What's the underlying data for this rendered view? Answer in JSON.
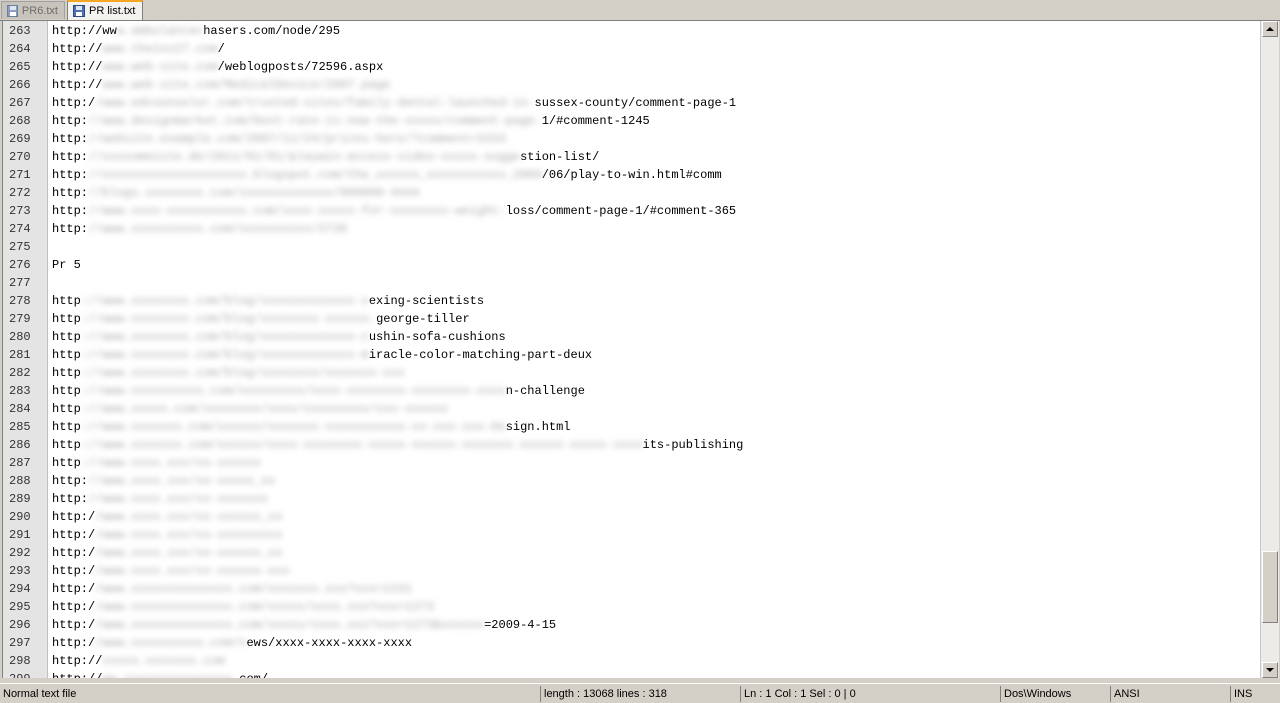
{
  "tabs": [
    {
      "label": "PR6.txt",
      "active": false
    },
    {
      "label": "PR list.txt",
      "active": true
    }
  ],
  "editor": {
    "lines": [
      {
        "n": "263",
        "pre": "http://ww",
        "blur": "w.ambulancec",
        "post": "hasers.com/node/295"
      },
      {
        "n": "264",
        "pre": "http://",
        "blur": "www.the1xx27.com",
        "post": "/"
      },
      {
        "n": "265",
        "pre": "http://",
        "blur": "www.web-site.com",
        "post": "/weblogposts/72596.aspx"
      },
      {
        "n": "266",
        "pre": "http://",
        "blur": "www.web-site.com/MedicalDevice/2007.page",
        "post": ""
      },
      {
        "n": "267",
        "pre": "http:/",
        "blur": "/www.edcounselor.com/trusted-sites/family-dental-launched-in-",
        "post": "sussex-county/comment-page-1"
      },
      {
        "n": "268",
        "pre": "http:",
        "blur": "//www.designmarket.com/best-rate-is-now-the-xxxxx/comment-page-",
        "post": "1/#comment-1245"
      },
      {
        "n": "269",
        "pre": "http:",
        "blur": "//website.example.com/2007/11/24/prices-here/?comment=3333",
        "post": ""
      },
      {
        "n": "270",
        "pre": "http:",
        "blur": "//xxxsomesite.de/2011/01/01/playwin-access-video-xxxxx-sugge",
        "post": "stion-list/"
      },
      {
        "n": "271",
        "pre": "http:",
        "blur": "//xxxxxxxxxxxxxxxxxxxx.blogspot.com/the_xxxxxx_xxxxxxxxxxx_2009",
        "post": "/06/play-to-win.html#comm"
      },
      {
        "n": "272",
        "pre": "http:",
        "blur": "//blogs.xxxxxxxx.com/xxxxxxxxxxxxx/000000-4444",
        "post": ""
      },
      {
        "n": "273",
        "pre": "http:",
        "blur": "//www.xxxx-xxxxxxxxxxx.com/xxxx-xxxxx-for-xxxxxxxx-weight-",
        "post": "loss/comment-page-1/#comment-365"
      },
      {
        "n": "274",
        "pre": "http:",
        "blur": "//www.xxxxxxxxxx.com/xxxxxxxxxx/2720",
        "post": ""
      },
      {
        "n": "275",
        "pre": "",
        "blur": "",
        "post": ""
      },
      {
        "n": "276",
        "pre": "Pr 5",
        "blur": "",
        "post": ""
      },
      {
        "n": "277",
        "pre": "",
        "blur": "",
        "post": ""
      },
      {
        "n": "278",
        "pre": "http",
        "blur": "://www.xxxxxxxx.com/blog/xxxxxxxxxxxxx-v",
        "post": "exing-scientists"
      },
      {
        "n": "279",
        "pre": "http",
        "blur": "://www.xxxxxxxx.com/blog/xxxxxxxx-xxxxxx-",
        "post": "george-tiller"
      },
      {
        "n": "280",
        "pre": "http",
        "blur": "://www.xxxxxxxx.com/blog/xxxxxxxxxxxxx-c",
        "post": "ushin-sofa-cushions"
      },
      {
        "n": "281",
        "pre": "http",
        "blur": "://www.xxxxxxxx.com/blog/xxxxxxxxxxxxx-m",
        "post": "iracle-color-matching-part-deux"
      },
      {
        "n": "282",
        "pre": "http",
        "blur": "://www.xxxxxxxx.com/blog/xxxxxxxx/xxxxxxx-xxx",
        "post": ""
      },
      {
        "n": "283",
        "pre": "http",
        "blur": "://www.xxxxxxxxxx.com/xxxxxxxxx/xxxx-xxxxxxxx-xxxxxxxx-xxxx",
        "post": "n-challenge"
      },
      {
        "n": "284",
        "pre": "http",
        "blur": "://www.xxxxx.com/xxxxxxxx/xxxx/xxxxxxxxx/xxx-xxxxxx",
        "post": ""
      },
      {
        "n": "285",
        "pre": "http",
        "blur": "://www.xxxxxxx.com/xxxxxx/xxxxxxx-xxxxxxxxxxx-xx-xxx-xxx-De",
        "post": "sign.html"
      },
      {
        "n": "286",
        "pre": "http",
        "blur": "://www.xxxxxxx.com/xxxxxx/xxxx-xxxxxxxx-xxxxx-xxxxxx-xxxxxxx-xxxxxx-xxxxx-xxxx",
        "post": "its-publishing"
      },
      {
        "n": "287",
        "pre": "http",
        "blur": "://www.xxxx.xxx/xx-xxxxxx",
        "post": ""
      },
      {
        "n": "288",
        "pre": "http:",
        "blur": "//www.xxxx.xxx/xx-xxxxx_xx",
        "post": ""
      },
      {
        "n": "289",
        "pre": "http:",
        "blur": "//www.xxxx.xxx/xx-xxxxxxx",
        "post": ""
      },
      {
        "n": "290",
        "pre": "http:/",
        "blur": "/www.xxxx.xxx/xx-xxxxxx_xx",
        "post": ""
      },
      {
        "n": "291",
        "pre": "http:/",
        "blur": "/www.xxxx.xxx/xx-xxxxxxxxx",
        "post": ""
      },
      {
        "n": "292",
        "pre": "http:/",
        "blur": "/www.xxxx.xxx/xx-xxxxxx_xx",
        "post": ""
      },
      {
        "n": "293",
        "pre": "http:/",
        "blur": "/www.xxxx.xxx/xx-xxxxxx-xxx",
        "post": ""
      },
      {
        "n": "294",
        "pre": "http:/",
        "blur": "/www.xxxxxxxxxxxxxx.com/xxxxxxx.xxx?xxx=1231",
        "post": ""
      },
      {
        "n": "295",
        "pre": "http:/",
        "blur": "/www.xxxxxxxxxxxxxx.com/xxxxx/xxxx.xxx?xxx=1273",
        "post": ""
      },
      {
        "n": "296",
        "pre": "http:/",
        "blur": "/www.xxxxxxxxxxxxxx.com/xxxxx/xxxx.xxx?xxx=1273&xxxxxx",
        "post": "=2009-4-15"
      },
      {
        "n": "297",
        "pre": "http:/",
        "blur": "/www.xxxxxxxxxx.com/n",
        "post": "ews/xxxx-xxxx-xxxx-xxxx"
      },
      {
        "n": "298",
        "pre": "http://",
        "blur": "xxxxx.xxxxxxx.com",
        "post": ""
      },
      {
        "n": "299",
        "pre": "http://",
        "blur": "ww.xxxxxxxxxxxxxxx.",
        "post": "com/"
      }
    ]
  },
  "statusbar": {
    "filetype": "Normal text file",
    "length": "length : 13068    lines : 318",
    "position": "Ln : 1    Col : 1    Sel : 0 | 0",
    "eol": "Dos\\Windows",
    "encoding": "ANSI",
    "mode": "INS"
  }
}
